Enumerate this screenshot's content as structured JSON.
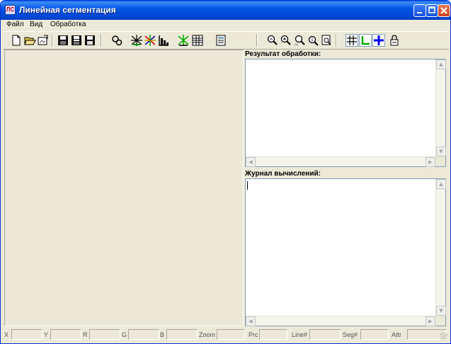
{
  "window": {
    "title": "Линейная сегментация",
    "app_icon_text": "ЛС"
  },
  "menu": [
    {
      "label": "Файл"
    },
    {
      "label": "Вид"
    },
    {
      "label": "Обработка"
    }
  ],
  "toolbar": {
    "buttons": [
      {
        "name": "new-document-icon"
      },
      {
        "name": "open-folder-icon"
      },
      {
        "name": "open-image-icon"
      },
      {
        "name": "save-icon"
      },
      {
        "name": "save-all-icon"
      },
      {
        "name": "save-as-icon"
      },
      {
        "name": "process-icon"
      },
      {
        "name": "segment-icon"
      },
      {
        "name": "segment-color-icon"
      },
      {
        "name": "histogram-icon"
      },
      {
        "name": "lines-green-icon"
      },
      {
        "name": "table-icon"
      },
      {
        "name": "calculator-icon"
      },
      {
        "name": "zoom-out-icon"
      },
      {
        "name": "zoom-in-icon"
      },
      {
        "name": "zoom-region-icon"
      },
      {
        "name": "zoom-fit-icon"
      },
      {
        "name": "zoom-page-icon"
      },
      {
        "name": "grid-icon",
        "checked": true
      },
      {
        "name": "axes-icon",
        "checked": true
      },
      {
        "name": "crosshair-icon",
        "checked": true
      },
      {
        "name": "lock-icon"
      }
    ]
  },
  "result_panel": {
    "label": "Результат обработки:",
    "text": ""
  },
  "log_panel": {
    "label": "Журнал вычислений:",
    "text": ""
  },
  "status": {
    "fields": [
      {
        "label": "X",
        "value": ""
      },
      {
        "label": "Y",
        "value": ""
      },
      {
        "label": "R",
        "value": ""
      },
      {
        "label": "G",
        "value": ""
      },
      {
        "label": "B",
        "value": ""
      },
      {
        "label": "Zoom",
        "value": ""
      },
      {
        "label": "Prc",
        "value": ""
      },
      {
        "label": "Line#",
        "value": ""
      },
      {
        "label": "Seg#",
        "value": ""
      },
      {
        "label": "Attr",
        "value": ""
      }
    ]
  },
  "colors": {
    "titlebar": "#0054e3",
    "face": "#ece9d8",
    "accent_green": "#00a000",
    "accent_blue": "#0000ff"
  }
}
